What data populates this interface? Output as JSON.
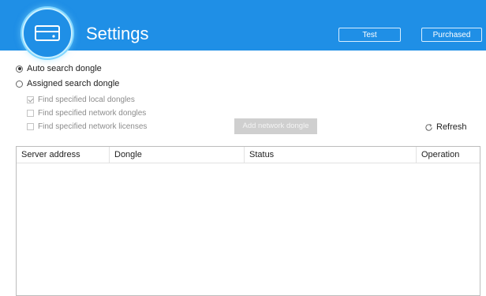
{
  "header": {
    "title": "Settings",
    "icon": "server-drive-icon",
    "test_label": "Test",
    "purchased_label": "Purchased",
    "background_color": "#1f8fe6"
  },
  "search_mode": {
    "auto_label": "Auto search dongle",
    "assigned_label": "Assigned search dongle",
    "selected": "auto"
  },
  "filters": [
    {
      "label": "Find specified local dongles",
      "checked": true
    },
    {
      "label": "Find specified network dongles",
      "checked": false
    },
    {
      "label": "Find specified network licenses",
      "checked": false
    }
  ],
  "add_network_dongle_label": "Add network dongle",
  "refresh_label": "Refresh",
  "table": {
    "columns": [
      "Server address",
      "Dongle",
      "Status",
      "Operation"
    ],
    "rows": []
  }
}
